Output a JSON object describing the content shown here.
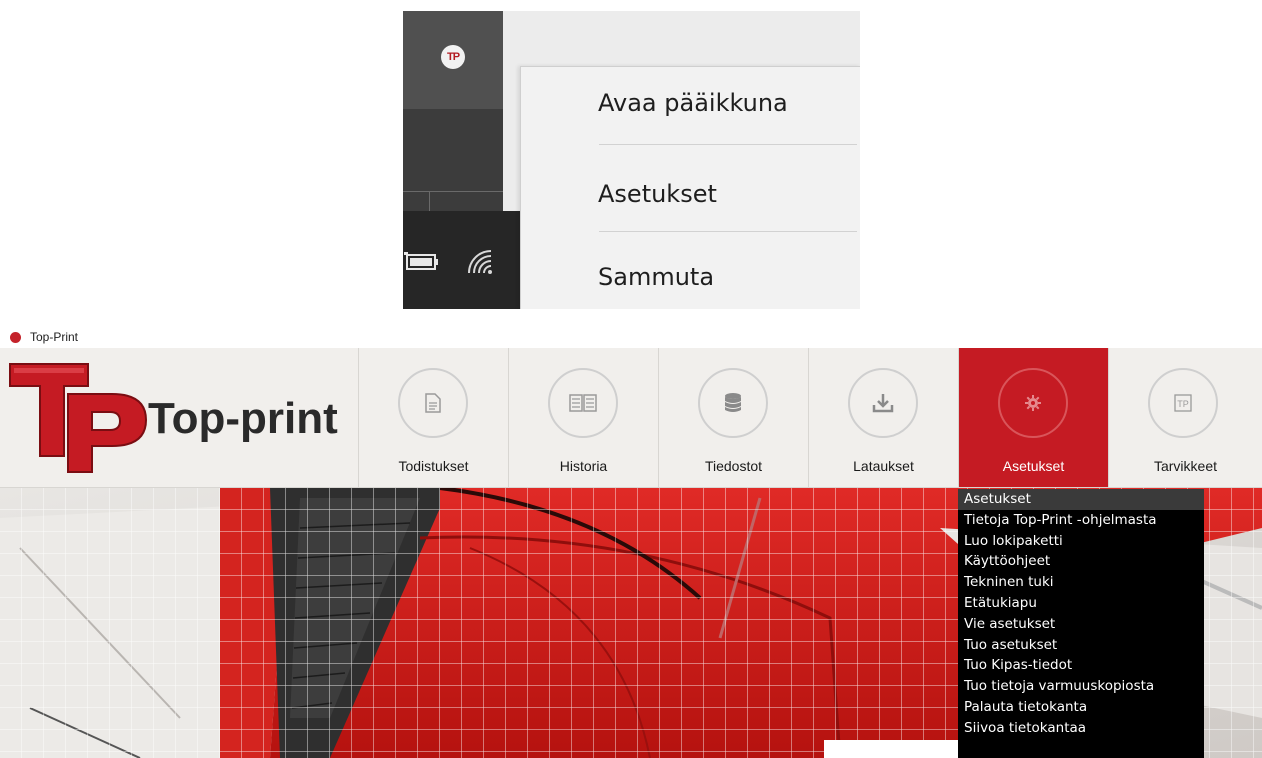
{
  "tray_menu": {
    "items": [
      {
        "label": "Avaa pääikkuna"
      },
      {
        "label": "Asetukset"
      },
      {
        "label": "Sammuta"
      }
    ],
    "tray_icon_text": "TP",
    "icons": [
      "tp-tray-icon",
      "battery-icon",
      "wifi-icon"
    ]
  },
  "window": {
    "title": "Top-Print",
    "logo_text": "Top-print",
    "nav": [
      {
        "label": "Todistukset",
        "icon": "document-icon"
      },
      {
        "label": "Historia",
        "icon": "book-icon"
      },
      {
        "label": "Tiedostot",
        "icon": "database-icon"
      },
      {
        "label": "Lataukset",
        "icon": "download-icon"
      },
      {
        "label": "Asetukset",
        "icon": "gear-icon",
        "active": true
      },
      {
        "label": "Tarvikkeet",
        "icon": "tp-icon",
        "icon_text": "TP"
      }
    ],
    "settings_dropdown": {
      "selected": "Asetukset",
      "items": [
        "Asetukset",
        "Tietoja Top-Print -ohjelmasta",
        "Luo lokipaketti",
        "Käyttöohjeet",
        "Tekninen tuki",
        "Etätukiapu",
        "Vie asetukset",
        "Tuo asetukset",
        "Tuo Kipas-tiedot",
        "Tuo tietoja varmuuskopiosta",
        "Palauta tietokanta",
        "Siivoa tietokantaa"
      ]
    }
  },
  "colors": {
    "brand_red": "#c51b23",
    "toolbar_bg": "#f1efec",
    "dropdown_bg": "#000000",
    "menu_bg": "#f2f2f2"
  }
}
